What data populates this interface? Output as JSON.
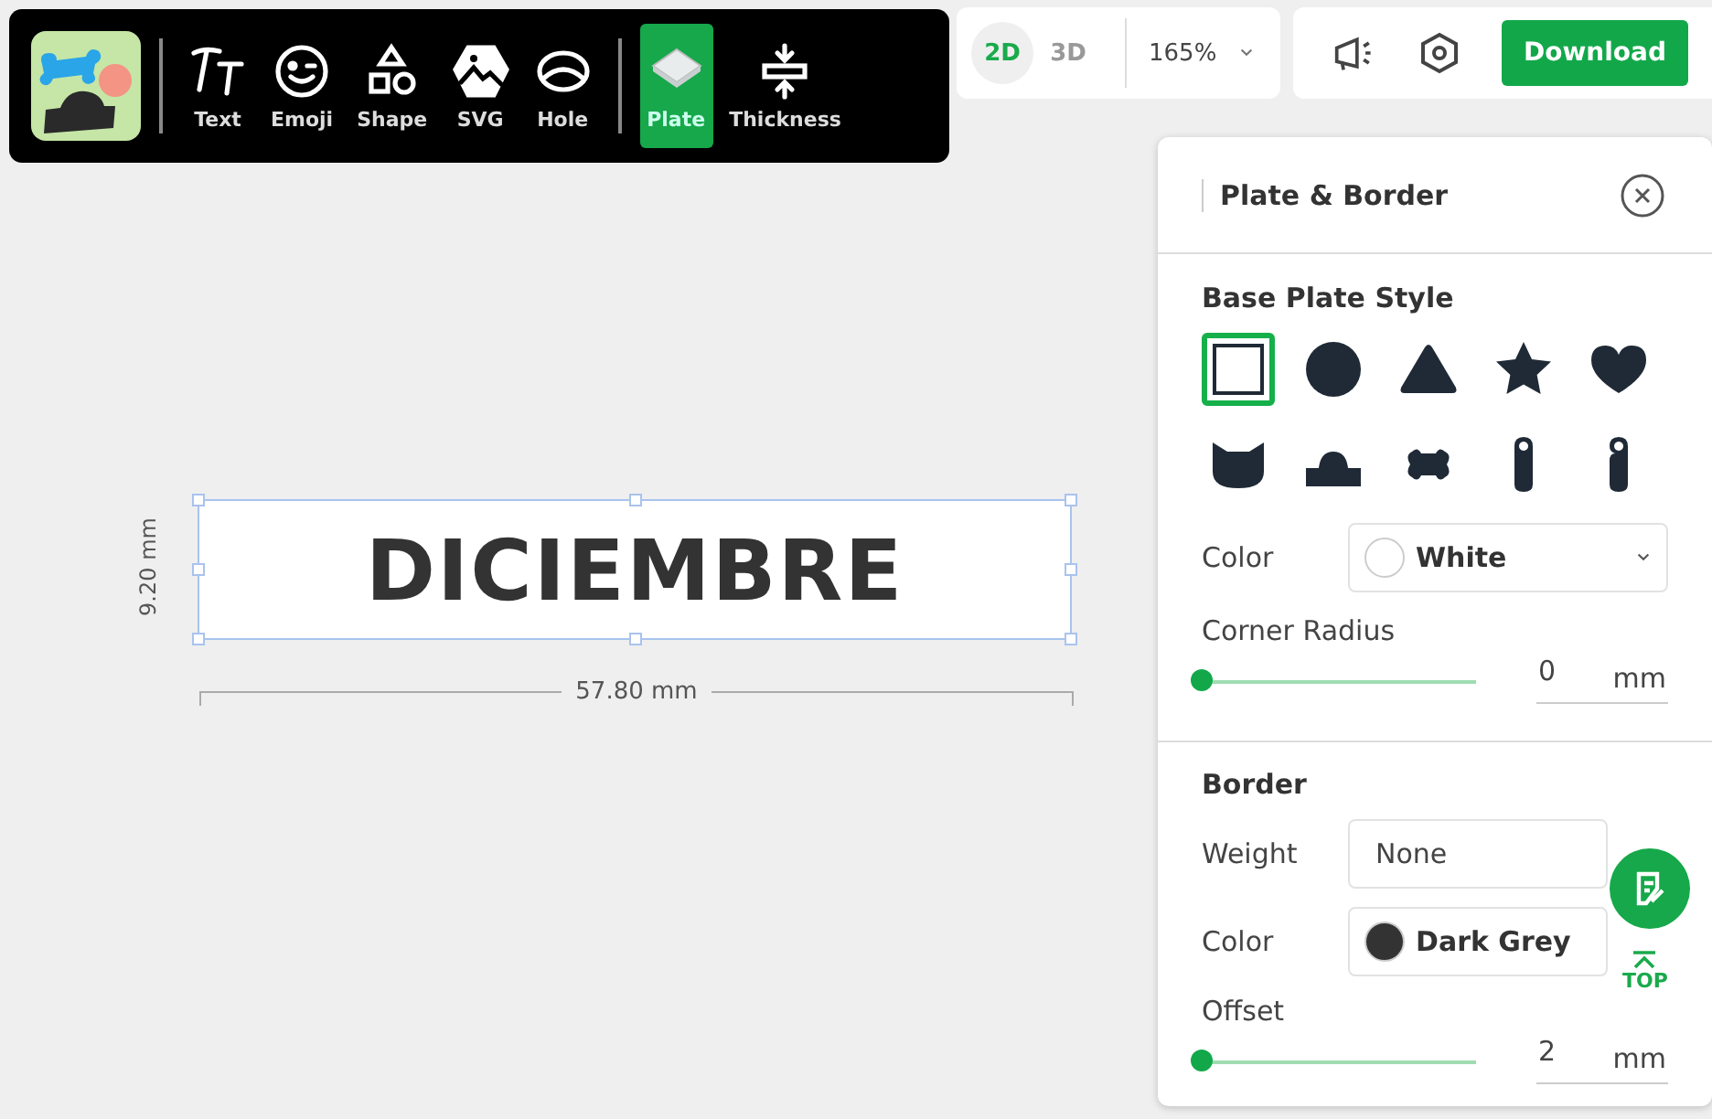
{
  "toolbar": {
    "tools": [
      {
        "label": "Text",
        "kind": "text",
        "selected": false
      },
      {
        "label": "Emoji",
        "kind": "emoji",
        "selected": false
      },
      {
        "label": "Shape",
        "kind": "shape",
        "selected": false
      },
      {
        "label": "SVG",
        "kind": "svg",
        "selected": false
      },
      {
        "label": "Hole",
        "kind": "hole",
        "selected": false
      },
      {
        "label": "Plate",
        "kind": "plate",
        "selected": true
      },
      {
        "label": "Thickness",
        "kind": "thickness",
        "selected": false
      }
    ]
  },
  "view": {
    "modes": [
      {
        "label": "2D",
        "selected": true
      },
      {
        "label": "3D",
        "selected": false
      }
    ],
    "zoom": "165%"
  },
  "actions": {
    "download": "Download"
  },
  "canvas": {
    "text": "DICIEMBRE",
    "height": "9.20 mm",
    "width": "57.80 mm"
  },
  "panel": {
    "title": "Plate & Border",
    "base": {
      "heading": "Base Plate Style",
      "shapes": [
        {
          "kind": "square",
          "selected": true
        },
        {
          "kind": "circle",
          "selected": false
        },
        {
          "kind": "triangle",
          "selected": false
        },
        {
          "kind": "star",
          "selected": false
        },
        {
          "kind": "heart",
          "selected": false
        },
        {
          "kind": "cat",
          "selected": false
        },
        {
          "kind": "arch",
          "selected": false
        },
        {
          "kind": "bone",
          "selected": false
        },
        {
          "kind": "tag",
          "selected": false
        },
        {
          "kind": "hanger",
          "selected": false
        }
      ],
      "color_label": "Color",
      "color_value": "White",
      "color": "#ffffff",
      "radius_label": "Corner Radius",
      "radius_value": "0",
      "radius_unit": "mm",
      "level": 0
    },
    "border": {
      "heading": "Border",
      "weight_label": "Weight",
      "weight_value": "None",
      "color_label": "Color",
      "color_value": "Dark Grey",
      "color": "#333333",
      "offset_label": "Offset",
      "offset_value": "2",
      "offset_unit": "mm",
      "level": 0
    }
  },
  "top_button": "TOP"
}
